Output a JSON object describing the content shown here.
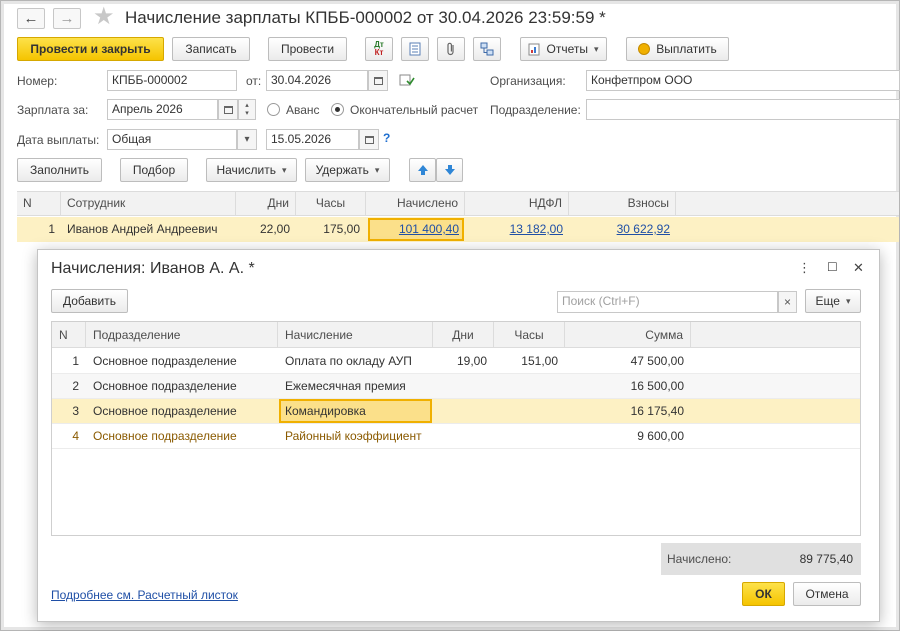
{
  "window": {
    "title": "Начисление зарплаты КПББ-000002 от 30.04.2026 23:59:59 *",
    "back_icon": "←",
    "forward_icon": "→",
    "favorite_icon": "★"
  },
  "toolbar": {
    "post_close_label": "Провести и закрыть",
    "save_label": "Записать",
    "post_label": "Провести",
    "dt_kt_top": "Дт",
    "dt_kt_bottom": "Кт",
    "reports_label": "Отчеты",
    "pay_label": "Выплатить"
  },
  "form": {
    "number_label": "Номер:",
    "number_value": "КПББ-000002",
    "from_label": "от:",
    "date_value": "30.04.2026",
    "org_label": "Организация:",
    "org_value": "Конфетпром ООО",
    "salary_for_label": "Зарплата за:",
    "salary_for_value": "Апрель 2026",
    "advance_label": "Аванс",
    "final_label": "Окончательный расчет",
    "final_selected": true,
    "department_label": "Подразделение:",
    "department_value": "",
    "pay_date_label": "Дата выплаты:",
    "pay_date_mode": "Общая",
    "pay_date_value": "15.05.2026",
    "help_mark": "?"
  },
  "table_toolbar": {
    "fill_label": "Заполнить",
    "pick_label": "Подбор",
    "accrue_label": "Начислить",
    "deduct_label": "Удержать"
  },
  "main_table": {
    "columns": [
      "N",
      "Сотрудник",
      "Дни",
      "Часы",
      "Начислено",
      "НДФЛ",
      "Взносы"
    ],
    "rows": [
      {
        "n": "1",
        "employee": "Иванов Андрей Андреевич",
        "days": "22,00",
        "hours": "175,00",
        "accrued": "101 400,40",
        "ndfl": "13 182,00",
        "contributions": "30 622,92"
      }
    ]
  },
  "modal": {
    "title": "Начисления: Иванов А. А. *",
    "more_icon": "⋮",
    "maximize_icon": "☐",
    "close_icon": "✕",
    "add_label": "Добавить",
    "search_placeholder": "Поиск (Ctrl+F)",
    "search_clear": "×",
    "more_label": "Еще",
    "columns": [
      "N",
      "Подразделение",
      "Начисление",
      "Дни",
      "Часы",
      "Сумма"
    ],
    "rows": [
      {
        "n": "1",
        "department": "Основное подразделение",
        "accrual": "Оплата по окладу АУП",
        "days": "19,00",
        "hours": "151,00",
        "sum": "47 500,00"
      },
      {
        "n": "2",
        "department": "Основное подразделение",
        "accrual": "Ежемесячная премия",
        "days": "",
        "hours": "",
        "sum": "16 500,00"
      },
      {
        "n": "3",
        "department": "Основное подразделение",
        "accrual": "Командировка",
        "days": "",
        "hours": "",
        "sum": "16 175,40"
      },
      {
        "n": "4",
        "department": "Основное подразделение",
        "accrual": "Районный коэффициент",
        "days": "",
        "hours": "",
        "sum": "9 600,00"
      }
    ],
    "total_label": "Начислено:",
    "total_value": "89 775,40",
    "payslip_link": "Подробнее см. Расчетный листок",
    "ok_label": "ОК",
    "cancel_label": "Отмена"
  },
  "colors": {
    "accent_yellow": "#f5c400",
    "selected_row": "#fdf1c4",
    "link": "#1f4fa6",
    "brown_row_text": "#8a5a00"
  }
}
